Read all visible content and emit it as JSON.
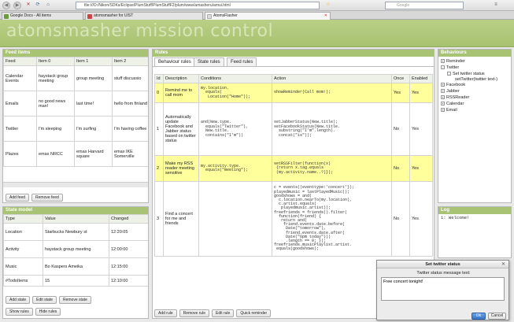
{
  "browser": {
    "url": "file:///D:/Nikon/SDKs/Eclipse/PlumStuff/PlumStuffF2/plum/www/amasheru/amui.html",
    "search_placeholder": "Google",
    "tabs": [
      {
        "label": "Google Docs - All items"
      },
      {
        "label": "atomsmasher for UIST"
      },
      {
        "label": "AtomsFlasher"
      }
    ]
  },
  "app": {
    "title": "atomsmasher mission control"
  },
  "feed": {
    "title": "Feed items",
    "headers": [
      "Feed",
      "Item 0",
      "Item 1",
      "Item 2"
    ],
    "rows": [
      [
        "Calendar Events",
        "haystack group meeting",
        "group meeting",
        "stuff discussio"
      ],
      [
        "Emails",
        "no good news man!",
        "last time!",
        "hello from finland"
      ],
      [
        "Twitter",
        "I'm sleeping",
        "I'm surfing",
        "I'm having coffee"
      ],
      [
        "Plazes",
        "emax NRCC",
        "emax Harvard square",
        "emax IKE Somerville"
      ]
    ],
    "buttons": [
      "Add feed",
      "Remove feed"
    ]
  },
  "state": {
    "title": "State model",
    "headers": [
      "Type",
      "Value",
      "Changed"
    ],
    "rows": [
      [
        "Location",
        "Starbucks Newbury st",
        "12:20:05"
      ],
      [
        "Activity",
        "haystack group meeting",
        "12:00:00"
      ],
      [
        "Music",
        "Bo Kaspers Ameika",
        "12:15:00"
      ],
      [
        "#TodoItems",
        "15",
        "12:10:00"
      ]
    ],
    "buttons": [
      "Add state",
      "Edit state",
      "Remove state"
    ],
    "bottom_buttons": [
      "Show rules",
      "Hide rules"
    ]
  },
  "rules": {
    "title": "Rules",
    "tabs": [
      "Behaviour rules",
      "State rules",
      "Feed rules"
    ],
    "headers": [
      "Id",
      "Description",
      "Conditions",
      "Action",
      "Once",
      "Enabled"
    ],
    "rows": [
      {
        "id": "0",
        "desc": "Remind me to call mom",
        "cond": "my.location.\n  equals(\n   Location(\"Home\"));",
        "action": "showReminder(Call mom!);",
        "once": "Yes",
        "enabled": "Yes"
      },
      {
        "id": "1",
        "desc": "Automatically update Facebook and Jabber status based on twitter status",
        "cond": "and(New.type.\n  equals(\"Twitter\"),\n  New.title.\n  contains(\"I'm\"))",
        "action": "setJabberStatus(New.title);\nsetFacebookStatus(New.title.\n  substring(\"I'm\".length).\n  concat(\"is\"));",
        "once": "No",
        "enabled": "Yes"
      },
      {
        "id": "2",
        "desc": "Make my RSS reader meeting sensitive",
        "cond": "my.activity.type.\n  equals(\"meeting\");",
        "action": "setRSSFilter(function(x)\n {return x.tag.equals\n (my.activity.name..?)});",
        "once": "No",
        "enabled": "Yes"
      },
      {
        "id": "3",
        "desc": "Find a concert for me and friends",
        "cond": "",
        "action": "c = events(|eventtype:'concert'});\nplayedmusic = lastPlayedMusic();\ngoodshows = and(\n  c.location.nearTo(my.location),\n  c.artist.equals(\n   playedmusic.artist));\nfreefriends = friends().filter(\n  function(friend) {\n   return and(\n    friend.events.date.before(\n     Date(\"tomorrow\"),\n     friend.events.date.after(\n     Date(\"6pm today\")))\n     .length == 0; });\nfreefriends.musicPlaylist.artist.\n equals(goodshows);",
        "once": "No",
        "enabled": "Yes"
      }
    ],
    "buttons": [
      "Add rule",
      "Remove rule",
      "Edit rule",
      "Quick reminder"
    ]
  },
  "behaviours": {
    "title": "Behaviours",
    "items": [
      {
        "label": "Reminder",
        "sign": "+"
      },
      {
        "label": "Twitter",
        "sign": "-"
      },
      {
        "label": "Set twitter status",
        "sign": "-"
      },
      {
        "label": "setTwitter(twitter text-)",
        "sign": ""
      },
      {
        "label": "Facebook",
        "sign": "+"
      },
      {
        "label": "Jabber",
        "sign": "+"
      },
      {
        "label": "RSSReader",
        "sign": "+"
      },
      {
        "label": "Calendar",
        "sign": "+"
      },
      {
        "label": "Email",
        "sign": "+"
      }
    ]
  },
  "log": {
    "title": "Log",
    "text": "1: Welcome!"
  },
  "dialog": {
    "title": "Set twitter status",
    "label": "Twitter status message text:",
    "value": "Free concert tonight!",
    "ok": "Ok",
    "cancel": "Cancel"
  },
  "colors": {
    "accent": "#a8c374",
    "header": "#b9cf86",
    "highlight": "#ffff9c"
  }
}
